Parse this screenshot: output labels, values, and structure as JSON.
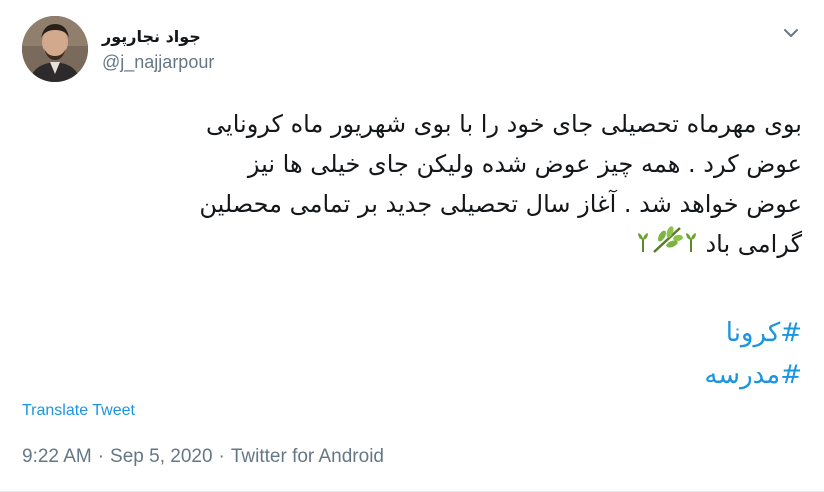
{
  "user": {
    "display_name": "جواد نجارپور",
    "handle": "@j_najjarpour",
    "avatar_icon": "person-photo"
  },
  "menu": {
    "icon": "chevron-down-icon"
  },
  "tweet": {
    "lines": [
      "بوی مهرماه تحصیلی جای خود را با بوی شهریور ماه کرونایی",
      "عوض کرد . همه چیز عوض شده ولیکن جای خیلی ها نیز",
      "عوض خواهد شد . آغاز سال تحصیلی جدید بر تمامی محصلین",
      "گرامی باد"
    ],
    "emojis": [
      "seedling-icon",
      "herb-icon",
      "seedling-icon"
    ],
    "hashtags": [
      "#کرونا",
      "#مدرسه"
    ]
  },
  "translate_label": "Translate Tweet",
  "meta": {
    "time": "9:22 AM",
    "separator": "·",
    "date": "Sep 5, 2020",
    "source": "Twitter for Android"
  },
  "colors": {
    "link": "#1b95e0",
    "muted": "#657786",
    "text": "#14171a"
  }
}
